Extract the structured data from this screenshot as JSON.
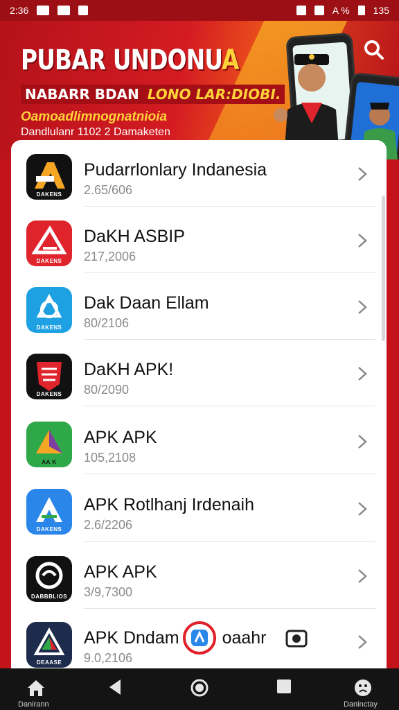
{
  "status_bar": {
    "time": "2:36",
    "right_text": "A %",
    "right_value": "135"
  },
  "banner": {
    "title_main": "PUBAR UNDONU",
    "title_end": "A",
    "sub_white": "NABARR BDAN",
    "sub_yellow": "LONO LAR:DIOBI.",
    "line3": "Oamoadlimnognatnioia",
    "line4": "Dandlulanr 1102 2 Damaketen",
    "accent": "#c4141b",
    "accent_yellow": "#ffd23a"
  },
  "apps": [
    {
      "name": "Pudarrlonlary Indanesia",
      "meta": "2.65/606",
      "icon": "black-orange-a-icon",
      "caption": "DAKENS",
      "bg": "#111111",
      "fg": "#f5a623"
    },
    {
      "name": "DaKH ASBIP",
      "meta": "217,2006",
      "icon": "red-arrow-icon",
      "caption": "DAKENS",
      "bg": "#e0242c",
      "fg": "#ffffff"
    },
    {
      "name": "Dak Daan Ellam",
      "meta": "80/2106",
      "icon": "blue-knot-icon",
      "caption": "DAKENS",
      "bg": "#1da1e2",
      "fg": "#ffffff"
    },
    {
      "name": "DaKH APK!",
      "meta": "80/2090",
      "icon": "red-shield-icon",
      "caption": "DAKENS",
      "bg": "#111111",
      "fg": "#e0242c"
    },
    {
      "name": "APK APK",
      "meta": "105,2108",
      "icon": "green-play-icon",
      "caption": "AA K",
      "bg": "#2fa84a",
      "fg": "#f5a623"
    },
    {
      "name": "APK Rotlhanj Irdenaih",
      "meta": "2.6/2206",
      "icon": "blue-a-icon",
      "caption": "DAKENS",
      "bg": "#2a86e8",
      "fg": "#ffffff"
    },
    {
      "name": "APK APK",
      "meta": "3/9,7300",
      "icon": "black-swirl-icon",
      "caption": "DABBBLIOS",
      "bg": "#111111",
      "fg": "#ffffff"
    },
    {
      "name": "APK Dndam",
      "name_tail": "oaahr",
      "meta": "9.0,2106",
      "icon": "navy-a-icon",
      "caption": "DEAASE",
      "bg": "#1d2b4c",
      "fg": "#2fa84a"
    }
  ],
  "nav": {
    "home_label": "Danirann",
    "right_label": "Daninctay"
  }
}
